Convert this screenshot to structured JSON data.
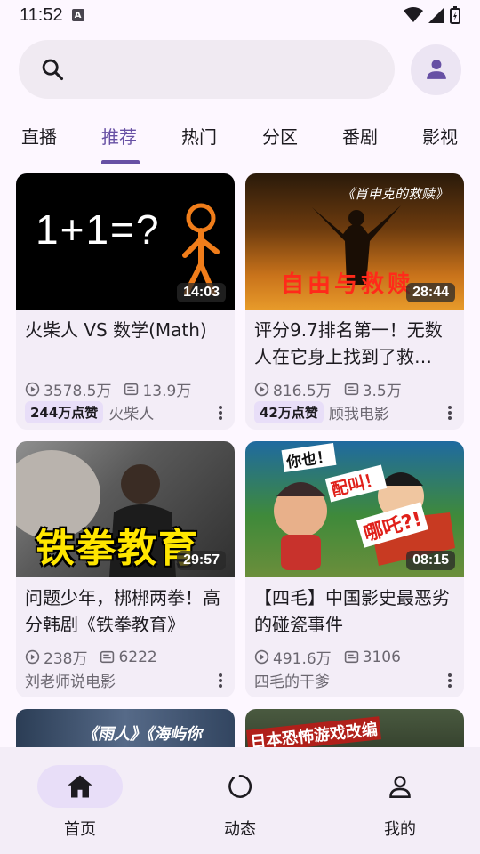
{
  "status": {
    "time": "11:52"
  },
  "search": {
    "placeholder": ""
  },
  "tabs": [
    {
      "label": "直播"
    },
    {
      "label": "推荐",
      "active": true
    },
    {
      "label": "热门"
    },
    {
      "label": "分区"
    },
    {
      "label": "番剧"
    },
    {
      "label": "影视"
    }
  ],
  "videos": [
    {
      "title": "火柴人 VS 数学(Math)",
      "duration": "14:03",
      "views": "3578.5万",
      "danmaku": "13.9万",
      "likes": "244万点赞",
      "author": "火柴人",
      "thumb_text": "1+1=?"
    },
    {
      "title": "评分9.7排名第一！无数人在它身上找到了救…",
      "duration": "28:44",
      "views": "816.5万",
      "danmaku": "3.5万",
      "likes": "42万点赞",
      "author": "顾我电影",
      "thumb_text": "自由与救赎",
      "thumb_caption": "《肖申克的救赎》"
    },
    {
      "title": "问题少年，梆梆两拳！高分韩剧《铁拳教育》",
      "duration": "29:57",
      "views": "238万",
      "danmaku": "6222",
      "likes": "",
      "author": "刘老师说电影",
      "thumb_text": "铁拳教育"
    },
    {
      "title": "【四毛】中国影史最恶劣的碰瓷事件",
      "duration": "08:15",
      "views": "491.6万",
      "danmaku": "3106",
      "likes": "",
      "author": "四毛的干爹",
      "thumb_text_1": "你也！",
      "thumb_text_2": "配叫！",
      "thumb_text_3": "哪吒?!"
    },
    {
      "thumb_text": "《雨人》《海屿你"
    },
    {
      "thumb_text": "日本恐怖游戏改编"
    }
  ],
  "nav": [
    {
      "label": "首页",
      "icon": "home-icon",
      "active": true
    },
    {
      "label": "动态",
      "icon": "dynamic-icon"
    },
    {
      "label": "我的",
      "icon": "profile-icon"
    }
  ],
  "colors": {
    "accent": "#6750a4",
    "surface": "#f3edf7",
    "pill": "#e8def8"
  }
}
